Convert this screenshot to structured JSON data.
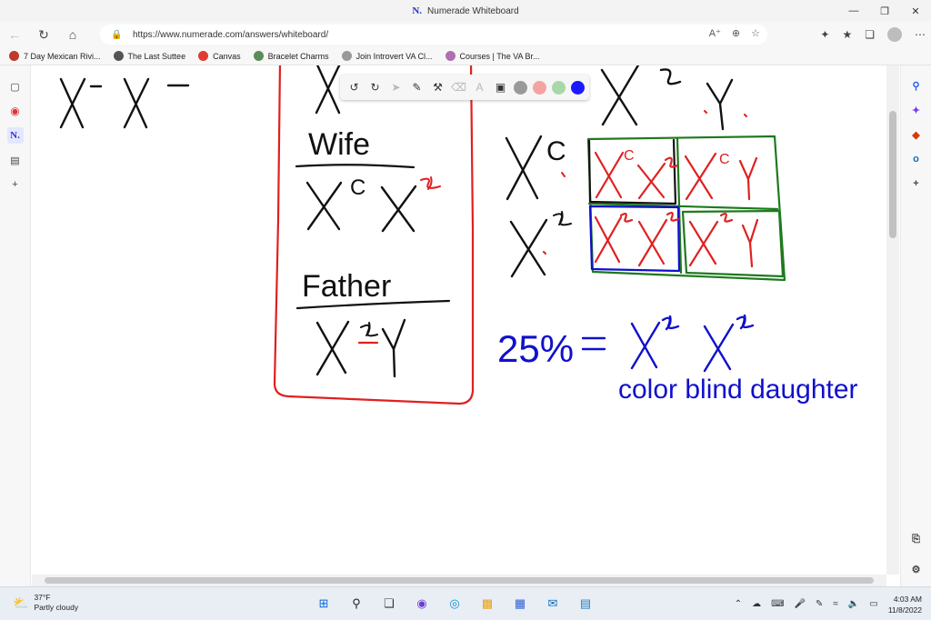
{
  "window": {
    "title": "Numerade Whiteboard",
    "logo": "N."
  },
  "address": {
    "url": "https://www.numerade.com/answers/whiteboard/"
  },
  "favorites": [
    {
      "label": "7 Day Mexican Rivi...",
      "color": "#c0392b"
    },
    {
      "label": "The Last Suttee",
      "color": "#555555"
    },
    {
      "label": "Canvas",
      "color": "#e03c31"
    },
    {
      "label": "Bracelet Charms",
      "color": "#5b8c5a"
    },
    {
      "label": "Join Introvert VA Cl...",
      "color": "#999999"
    },
    {
      "label": "Courses | The VA Br...",
      "color": "#b06fb0"
    }
  ],
  "sidebar_left": [
    {
      "icon": "tabs-icon",
      "glyph": "▢"
    },
    {
      "icon": "record-icon",
      "glyph": "◉"
    },
    {
      "icon": "numerade-icon",
      "glyph": "N."
    },
    {
      "icon": "collections-icon",
      "glyph": "▤"
    },
    {
      "icon": "add-icon",
      "glyph": "+"
    }
  ],
  "sidebar_right": [
    {
      "icon": "search-icon",
      "glyph": "⚲",
      "color": "#2563eb"
    },
    {
      "icon": "sparkle-icon",
      "glyph": "✦",
      "color": "#7c3aed"
    },
    {
      "icon": "office-icon",
      "glyph": "◆",
      "color": "#d83b01"
    },
    {
      "icon": "outlook-icon",
      "glyph": "o",
      "color": "#0f6cbd"
    },
    {
      "icon": "add-icon",
      "glyph": "+",
      "color": "#444444"
    }
  ],
  "whiteboard": {
    "colors": {
      "blue": "#1010cc",
      "red": "#e02020",
      "green": "#1e7a1e",
      "black": "#111111"
    },
    "swatches": [
      {
        "name": "gray",
        "color": "#9a9a9a"
      },
      {
        "name": "pink",
        "color": "#f4a3a3"
      },
      {
        "name": "light-green",
        "color": "#a8d8a8"
      },
      {
        "name": "blue",
        "color": "#1a1aff"
      }
    ],
    "labels": {
      "wife": "Wife",
      "father": "Father",
      "percent": "25%",
      "caption": "color blind daughter"
    }
  },
  "taskbar": {
    "weather_temp": "37°F",
    "weather_desc": "Partly cloudy",
    "time": "4:03 AM",
    "date": "11/8/2022"
  }
}
